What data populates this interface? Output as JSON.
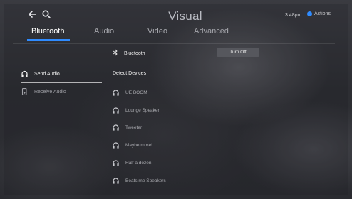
{
  "header": {
    "title": "Visual",
    "time": "3:48pm",
    "actions_label": "Actions",
    "icons": [
      "back-arrow-icon",
      "search-icon"
    ],
    "accent_color": "#2f8bff"
  },
  "tabs": [
    {
      "label": "Bluetooth",
      "active": true
    },
    {
      "label": "Audio",
      "active": false
    },
    {
      "label": "Video",
      "active": false
    },
    {
      "label": "Advanced",
      "active": false
    }
  ],
  "sidebar": {
    "items": [
      {
        "label": "Send Audio",
        "icon": "headphones-icon",
        "selected": true
      },
      {
        "label": "Receive Audio",
        "icon": "speaker-icon",
        "selected": false
      }
    ]
  },
  "bluetooth": {
    "label": "Bluetooth",
    "icon": "bluetooth-icon",
    "button_label": "Turn Off"
  },
  "devices": {
    "section_label": "Detect Devices",
    "items": [
      {
        "label": "UE BOOM",
        "icon": "headphones-icon"
      },
      {
        "label": "Lounge Speaker",
        "icon": "headphones-icon"
      },
      {
        "label": "Tweeter",
        "icon": "headphones-icon"
      },
      {
        "label": "Maybe more!",
        "icon": "headphones-icon"
      },
      {
        "label": "Half a dozen",
        "icon": "headphones-icon"
      },
      {
        "label": "Beats me Speakers",
        "icon": "headphones-icon"
      }
    ]
  }
}
